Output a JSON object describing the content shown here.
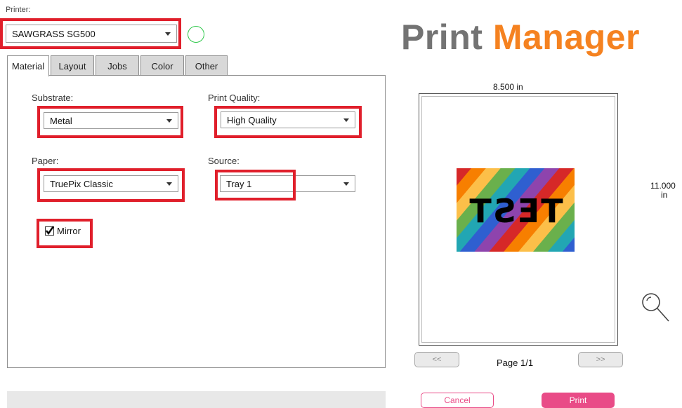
{
  "printer": {
    "label": "Printer:",
    "selected": "SAWGRASS SG500"
  },
  "app_title": {
    "part1": "Print",
    "part2": "Manager",
    "color1": "#737373",
    "color2": "#f58220"
  },
  "tabs": [
    {
      "label": "Material",
      "active": true
    },
    {
      "label": "Layout",
      "active": false
    },
    {
      "label": "Jobs",
      "active": false
    },
    {
      "label": "Color",
      "active": false
    },
    {
      "label": "Other",
      "active": false
    }
  ],
  "material": {
    "substrate": {
      "label": "Substrate:",
      "value": "Metal"
    },
    "print_quality": {
      "label": "Print Quality:",
      "value": "High Quality"
    },
    "paper": {
      "label": "Paper:",
      "value": "TruePix Classic"
    },
    "source": {
      "label": "Source:",
      "value": "Tray 1"
    },
    "mirror": {
      "label": "Mirror",
      "checked": true
    }
  },
  "preview": {
    "width_label": "8.500 in",
    "height_value": "11.000",
    "height_unit": "in",
    "image_text": "TEST",
    "prev_label": "<<",
    "next_label": ">>",
    "page_label": "Page 1/1"
  },
  "buttons": {
    "cancel": "Cancel",
    "print": "Print"
  },
  "colors": {
    "highlight_red": "#e01f2b",
    "status_green": "#2ec84a",
    "print_button": "#e94b87",
    "cancel_border": "#e94b87"
  }
}
